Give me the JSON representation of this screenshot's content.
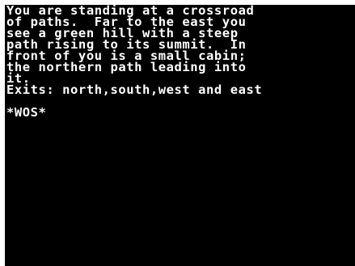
{
  "game": {
    "description_lines": [
      "You are standing at a crossroad",
      "of paths.  Far to the east you",
      "see a green hill with a steep",
      "path rising to its summit.  In",
      "front of you is a small cabin;",
      "the northern path leading into",
      "it."
    ],
    "exits_line": "Exits: north,south,west and east",
    "prompt": "*WOS*"
  },
  "colors": {
    "background": "#000000",
    "text": "#ffffff",
    "frame": "#ffffff"
  }
}
